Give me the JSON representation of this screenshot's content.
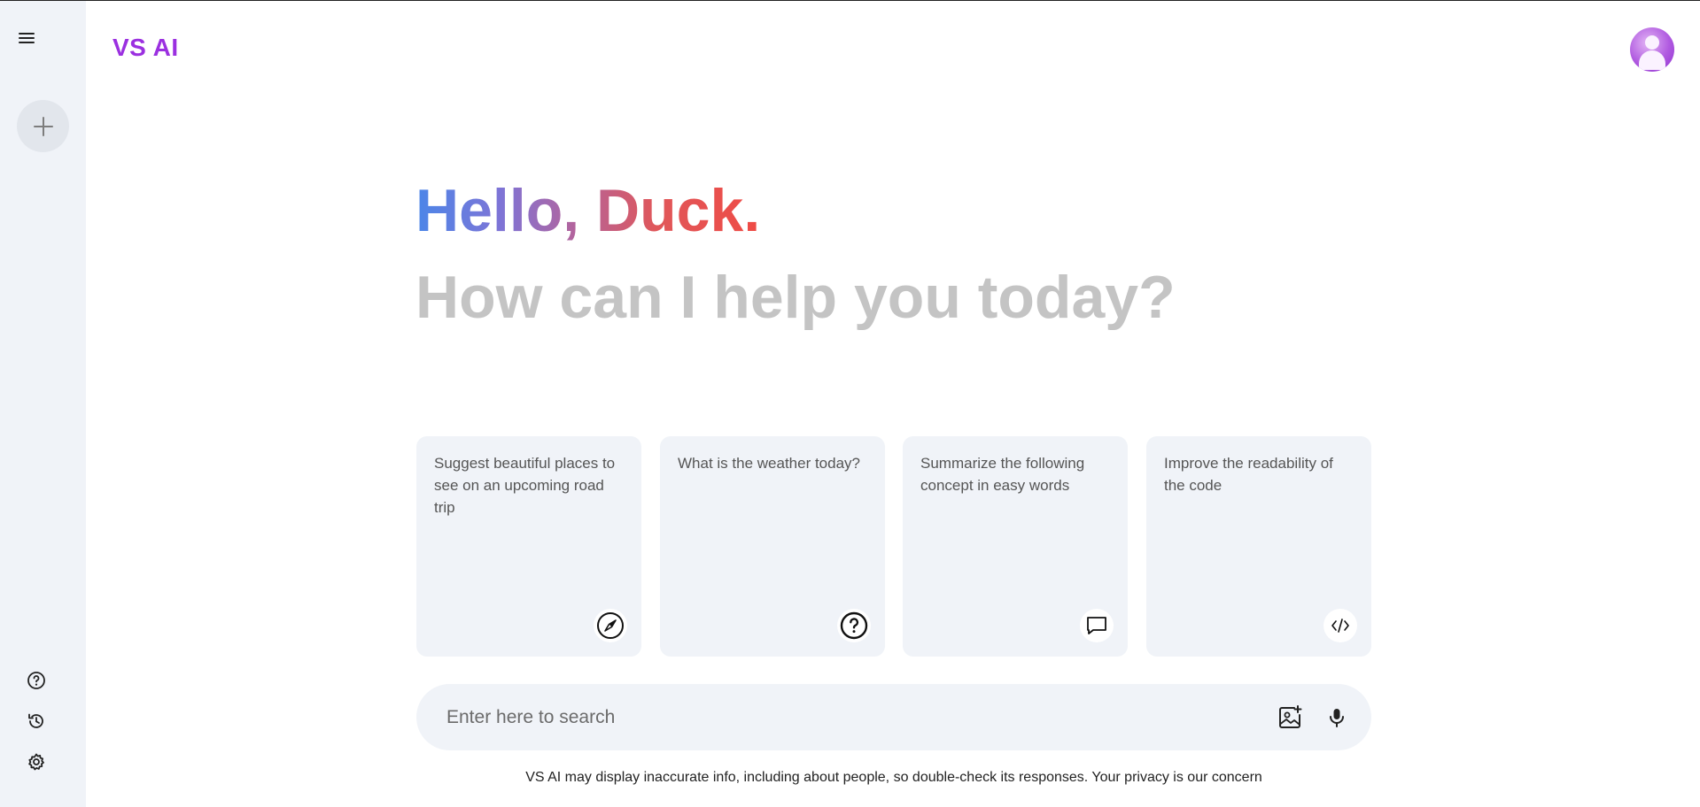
{
  "app": {
    "brand": "VS AI"
  },
  "sidebar": {
    "menu_icon": "hamburger-menu-icon",
    "new_chat_icon": "plus-icon",
    "bottom_icons": [
      "help-icon",
      "history-icon",
      "settings-icon"
    ]
  },
  "header": {
    "avatar_icon": "user-avatar-icon"
  },
  "greeting": {
    "hello": "Hello, Duck.",
    "subtitle": "How can I help you today?"
  },
  "cards": [
    {
      "text": "Suggest beautiful places to see on an upcoming road trip",
      "icon": "compass-icon"
    },
    {
      "text": "What is the weather today?",
      "icon": "question-icon"
    },
    {
      "text": "Summarize the following concept in easy words",
      "icon": "message-icon"
    },
    {
      "text": "Improve the readability of the code",
      "icon": "code-icon"
    }
  ],
  "search": {
    "placeholder": "Enter here to search",
    "value": "",
    "icons": [
      "add-image-icon",
      "microphone-icon"
    ]
  },
  "footer": {
    "note": "VS AI may display inaccurate info, including about people, so double-check its responses. Your privacy is our concern"
  },
  "colors": {
    "brand": "#9b30e0",
    "panel_bg": "#f0f3f8",
    "subtitle": "#c4c4c4",
    "gradient": [
      "#4b86e8",
      "#ef4b45"
    ]
  }
}
